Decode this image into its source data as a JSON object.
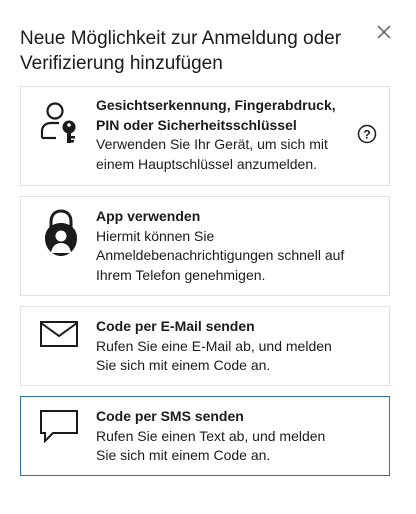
{
  "dialog": {
    "title": "Neue Möglichkeit zur Anmeldung oder Verifizierung hinzufügen",
    "close_icon": "close-icon"
  },
  "options": [
    {
      "title": "Gesichtserkennung, Fingerabdruck, PIN oder Sicherheitsschlüssel",
      "description": "Verwenden Sie Ihr Gerät, um sich mit einem Hauptschlüssel anzumelden.",
      "icon": "person-key-icon",
      "help_icon": "help-icon"
    },
    {
      "title": "App verwenden",
      "description": "Hiermit können Sie Anmeldebenachrichtigungen schnell auf Ihrem Telefon genehmigen.",
      "icon": "authenticator-lock-icon"
    },
    {
      "title": "Code per E-Mail senden",
      "description": "Rufen Sie eine E-Mail ab, und melden Sie sich mit einem Code an.",
      "icon": "envelope-icon"
    },
    {
      "title": "Code per SMS senden",
      "description": "Rufen Sie einen Text ab, und melden Sie sich mit einem Code an.",
      "icon": "chat-bubble-icon",
      "selected": true
    }
  ],
  "colors": {
    "selected_border": "#2f6ea8",
    "card_border": "#e1e1e1",
    "text": "#1b1b1b"
  }
}
